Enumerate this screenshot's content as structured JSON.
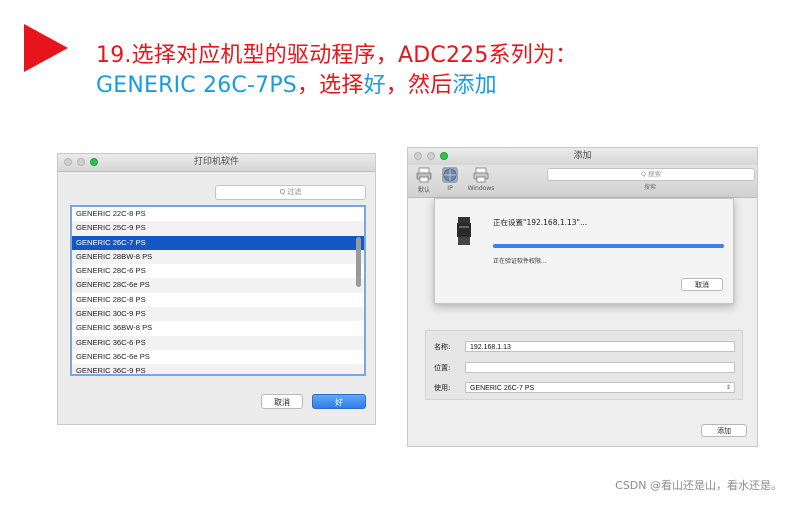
{
  "header": {
    "line1": "19.选择对应机型的驱动程序，ADC225系列为：",
    "line2_model": "GENERIC 26C-7PS",
    "line2_sep1": "，选择",
    "line2_good": "好",
    "line2_sep2": "，然后",
    "line2_add": "添加"
  },
  "left_window": {
    "title": "打印机软件",
    "search_placeholder": "Q 过滤",
    "items": [
      "GENERIC 22C-8 PS",
      "GENERIC 25C-9 PS",
      "GENERIC 26C-7 PS",
      "GENERIC 28BW-8 PS",
      "GENERIC 28C-6 PS",
      "GENERIC 28C-6e PS",
      "GENERIC 28C-8 PS",
      "GENERIC 30C-9 PS",
      "GENERIC 36BW-8 PS",
      "GENERIC 36C-6 PS",
      "GENERIC 36C-6e PS",
      "GENERIC 36C-9 PS"
    ],
    "selected_index": 2,
    "cancel_label": "取消",
    "ok_label": "好"
  },
  "right_window": {
    "title": "添加",
    "toolbar": {
      "default_label": "默认",
      "ip_label": "IP",
      "windows_label": "Windows",
      "search_placeholder": "Q 搜索",
      "search_label": "搜索"
    },
    "sheet": {
      "status": "正在设置\"192.168.1.13\"...",
      "progress": 1.0,
      "sub_status": "正在验证软件权限...",
      "cancel_label": "取消"
    },
    "form": {
      "name_label": "名称:",
      "name_value": "192.168.1.13",
      "location_label": "位置:",
      "location_value": "",
      "use_label": "使用:",
      "use_value": "GENERIC 26C-7 PS"
    },
    "add_label": "添加"
  },
  "footer": "CSDN @看山还是山，看水还是。",
  "colors": {
    "accent_red": "#e8141b",
    "accent_blue": "#1a9be0",
    "selection": "#1557c3"
  }
}
